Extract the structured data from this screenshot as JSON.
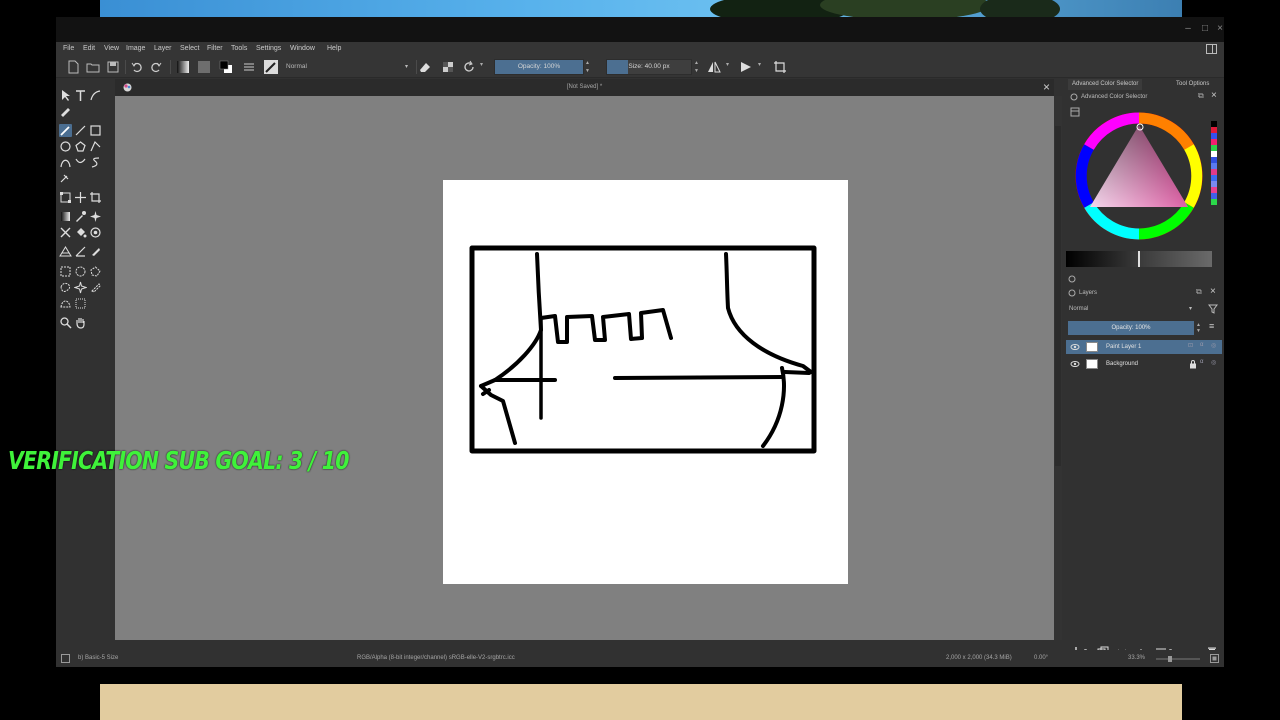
{
  "window": {
    "document_title": "[Not Saved]  *"
  },
  "menu": [
    "File",
    "Edit",
    "View",
    "Image",
    "Layer",
    "Select",
    "Filter",
    "Tools",
    "Settings",
    "Window",
    "Help"
  ],
  "toolbar": {
    "blend_mode": "Normal",
    "opacity_label": "Opacity: 100%",
    "opacity_value": 1.0,
    "size_label": "Size: 40.00 px",
    "size_value": 40.0
  },
  "dockers": {
    "tab_color": "Advanced Color Selector",
    "tab_tool_options": "Tool Options",
    "color_panel_title": "Advanced Color Selector",
    "layers_title": "Layers",
    "layer_blend_mode": "Normal",
    "layer_opacity_label": "Opacity:  100%",
    "layers": [
      {
        "name": "Paint Layer 1",
        "selected": true
      },
      {
        "name": "Background",
        "selected": false
      }
    ]
  },
  "status": {
    "brush_preset": "b) Basic-5 Size",
    "color_profile": "RGB/Alpha (8-bit integer/channel)  sRGB-elle-V2-srgbtrc.icc",
    "image_size": "2,000 x 2,000 (34.3 MiB)",
    "rotation": "0.00°",
    "zoom": "33.3%"
  },
  "overlay": {
    "text": "VERIFICATION SUB GOAL: 3 / 10",
    "color": "#3ff23a"
  },
  "colors": {
    "accent": "#4c6f91",
    "canvas_bg": "#808080",
    "panel_bg": "#313131"
  }
}
